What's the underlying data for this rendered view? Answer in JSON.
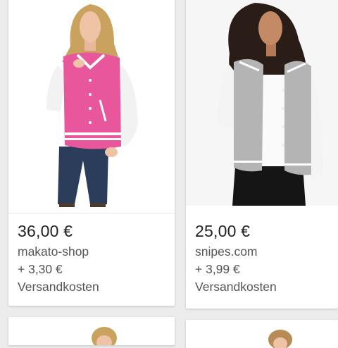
{
  "products": [
    {
      "price": "36,00 €",
      "store": "makato-shop",
      "shipping": "+ 3,30 €",
      "shipping_label": "Versandkosten",
      "image_icon": "pink-varsity-jacket-photo"
    },
    {
      "price": "25,00 €",
      "store": "snipes.com",
      "shipping": "+ 3,99 €",
      "shipping_label": "Versandkosten",
      "image_icon": "grey-varsity-jacket-photo"
    },
    {
      "image_icon": "product-photo-partial"
    },
    {
      "image_icon": "product-photo-partial"
    }
  ],
  "colors": {
    "background": "#ececec",
    "card": "#ffffff",
    "price_text": "#222222",
    "secondary_text": "#555555",
    "jacket_pink": "#e8579c",
    "jacket_grey": "#b4b4b4"
  }
}
